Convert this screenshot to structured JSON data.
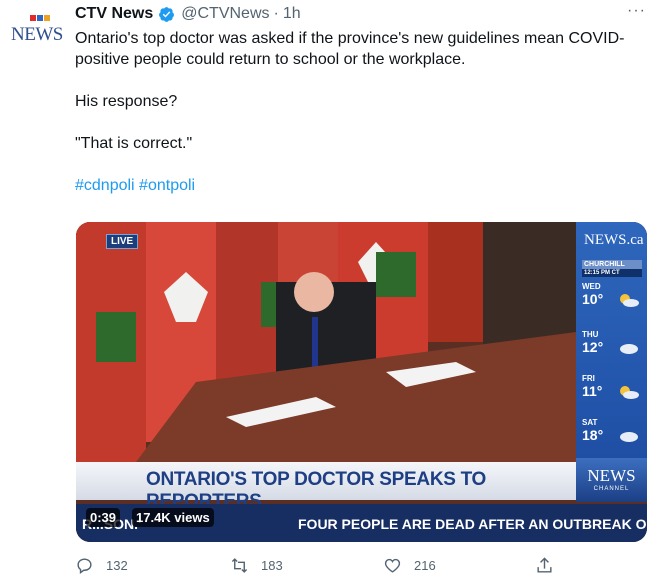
{
  "tweet": {
    "author_name": "CTV News",
    "handle": "@CTVNews",
    "separator": "·",
    "time": "1h",
    "more_label": "···",
    "avatar_text": "NEWS",
    "paragraphs": [
      "Ontario's top doctor was asked if the province's new guidelines mean COVID-positive people could return to school or the workplace.",
      "His response?",
      "\"That is correct.\""
    ],
    "hashtags": "#cdnpoli #ontpoli"
  },
  "video": {
    "live_badge": "LIVE",
    "headline": "ONTARIO'S TOP DOCTOR SPEAKS TO REPORTERS",
    "ticker_left": "R...SON.'",
    "ticker_right": "FOUR PEOPLE ARE DEAD AFTER AN OUTBREAK O",
    "duration": "0:39",
    "views": "17.4K views",
    "channel_logo": "NEWS",
    "channel_sub": "CHANNEL",
    "weather": {
      "logo": "NEWS.ca",
      "city": "CHURCHILL",
      "clock": "12:15 PM CT",
      "days": [
        {
          "day": "WED",
          "temp": "10°"
        },
        {
          "day": "THU",
          "temp": "12°"
        },
        {
          "day": "FRI",
          "temp": "11°"
        },
        {
          "day": "SAT",
          "temp": "18°"
        }
      ]
    }
  },
  "actions": {
    "reply_count": "132",
    "retweet_count": "183",
    "like_count": "216"
  },
  "colors": {
    "link": "#1d9bf0",
    "muted": "#536471",
    "verified": "#1d9bf0",
    "ctv_blue": "#1e3f84"
  }
}
